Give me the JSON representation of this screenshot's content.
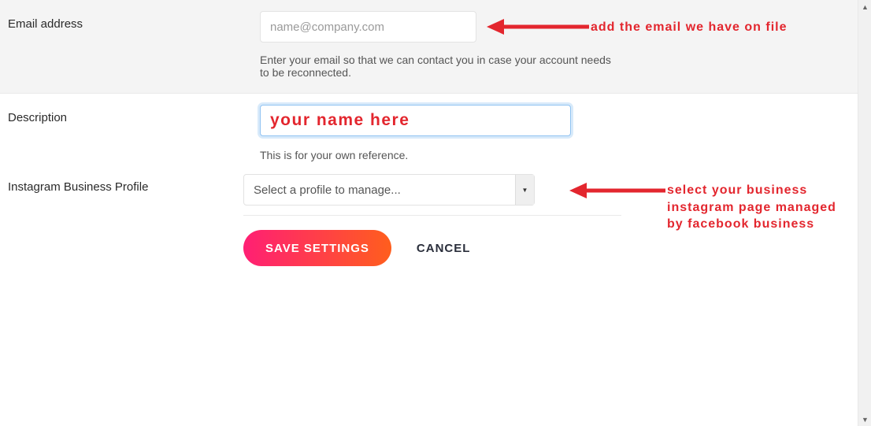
{
  "fields": {
    "email": {
      "label": "Email address",
      "placeholder": "name@company.com",
      "help": "Enter your email so that we can contact you in case your account needs to be reconnected."
    },
    "description": {
      "label": "Description",
      "value": "your name here",
      "help": "This is for your own reference."
    },
    "profile": {
      "label": "Instagram Business Profile",
      "selected": "Select a profile to manage..."
    }
  },
  "buttons": {
    "save": "SAVE SETTINGS",
    "cancel": "CANCEL"
  },
  "annotations": {
    "email": "add the email we have on file",
    "profile": "select your business instagram page managed by facebook business"
  },
  "colors": {
    "annotation": "#e3262e",
    "accentGradientStart": "#ff1f74",
    "accentGradientEnd": "#ff5e1d",
    "focusBorder": "#90c3f2"
  }
}
